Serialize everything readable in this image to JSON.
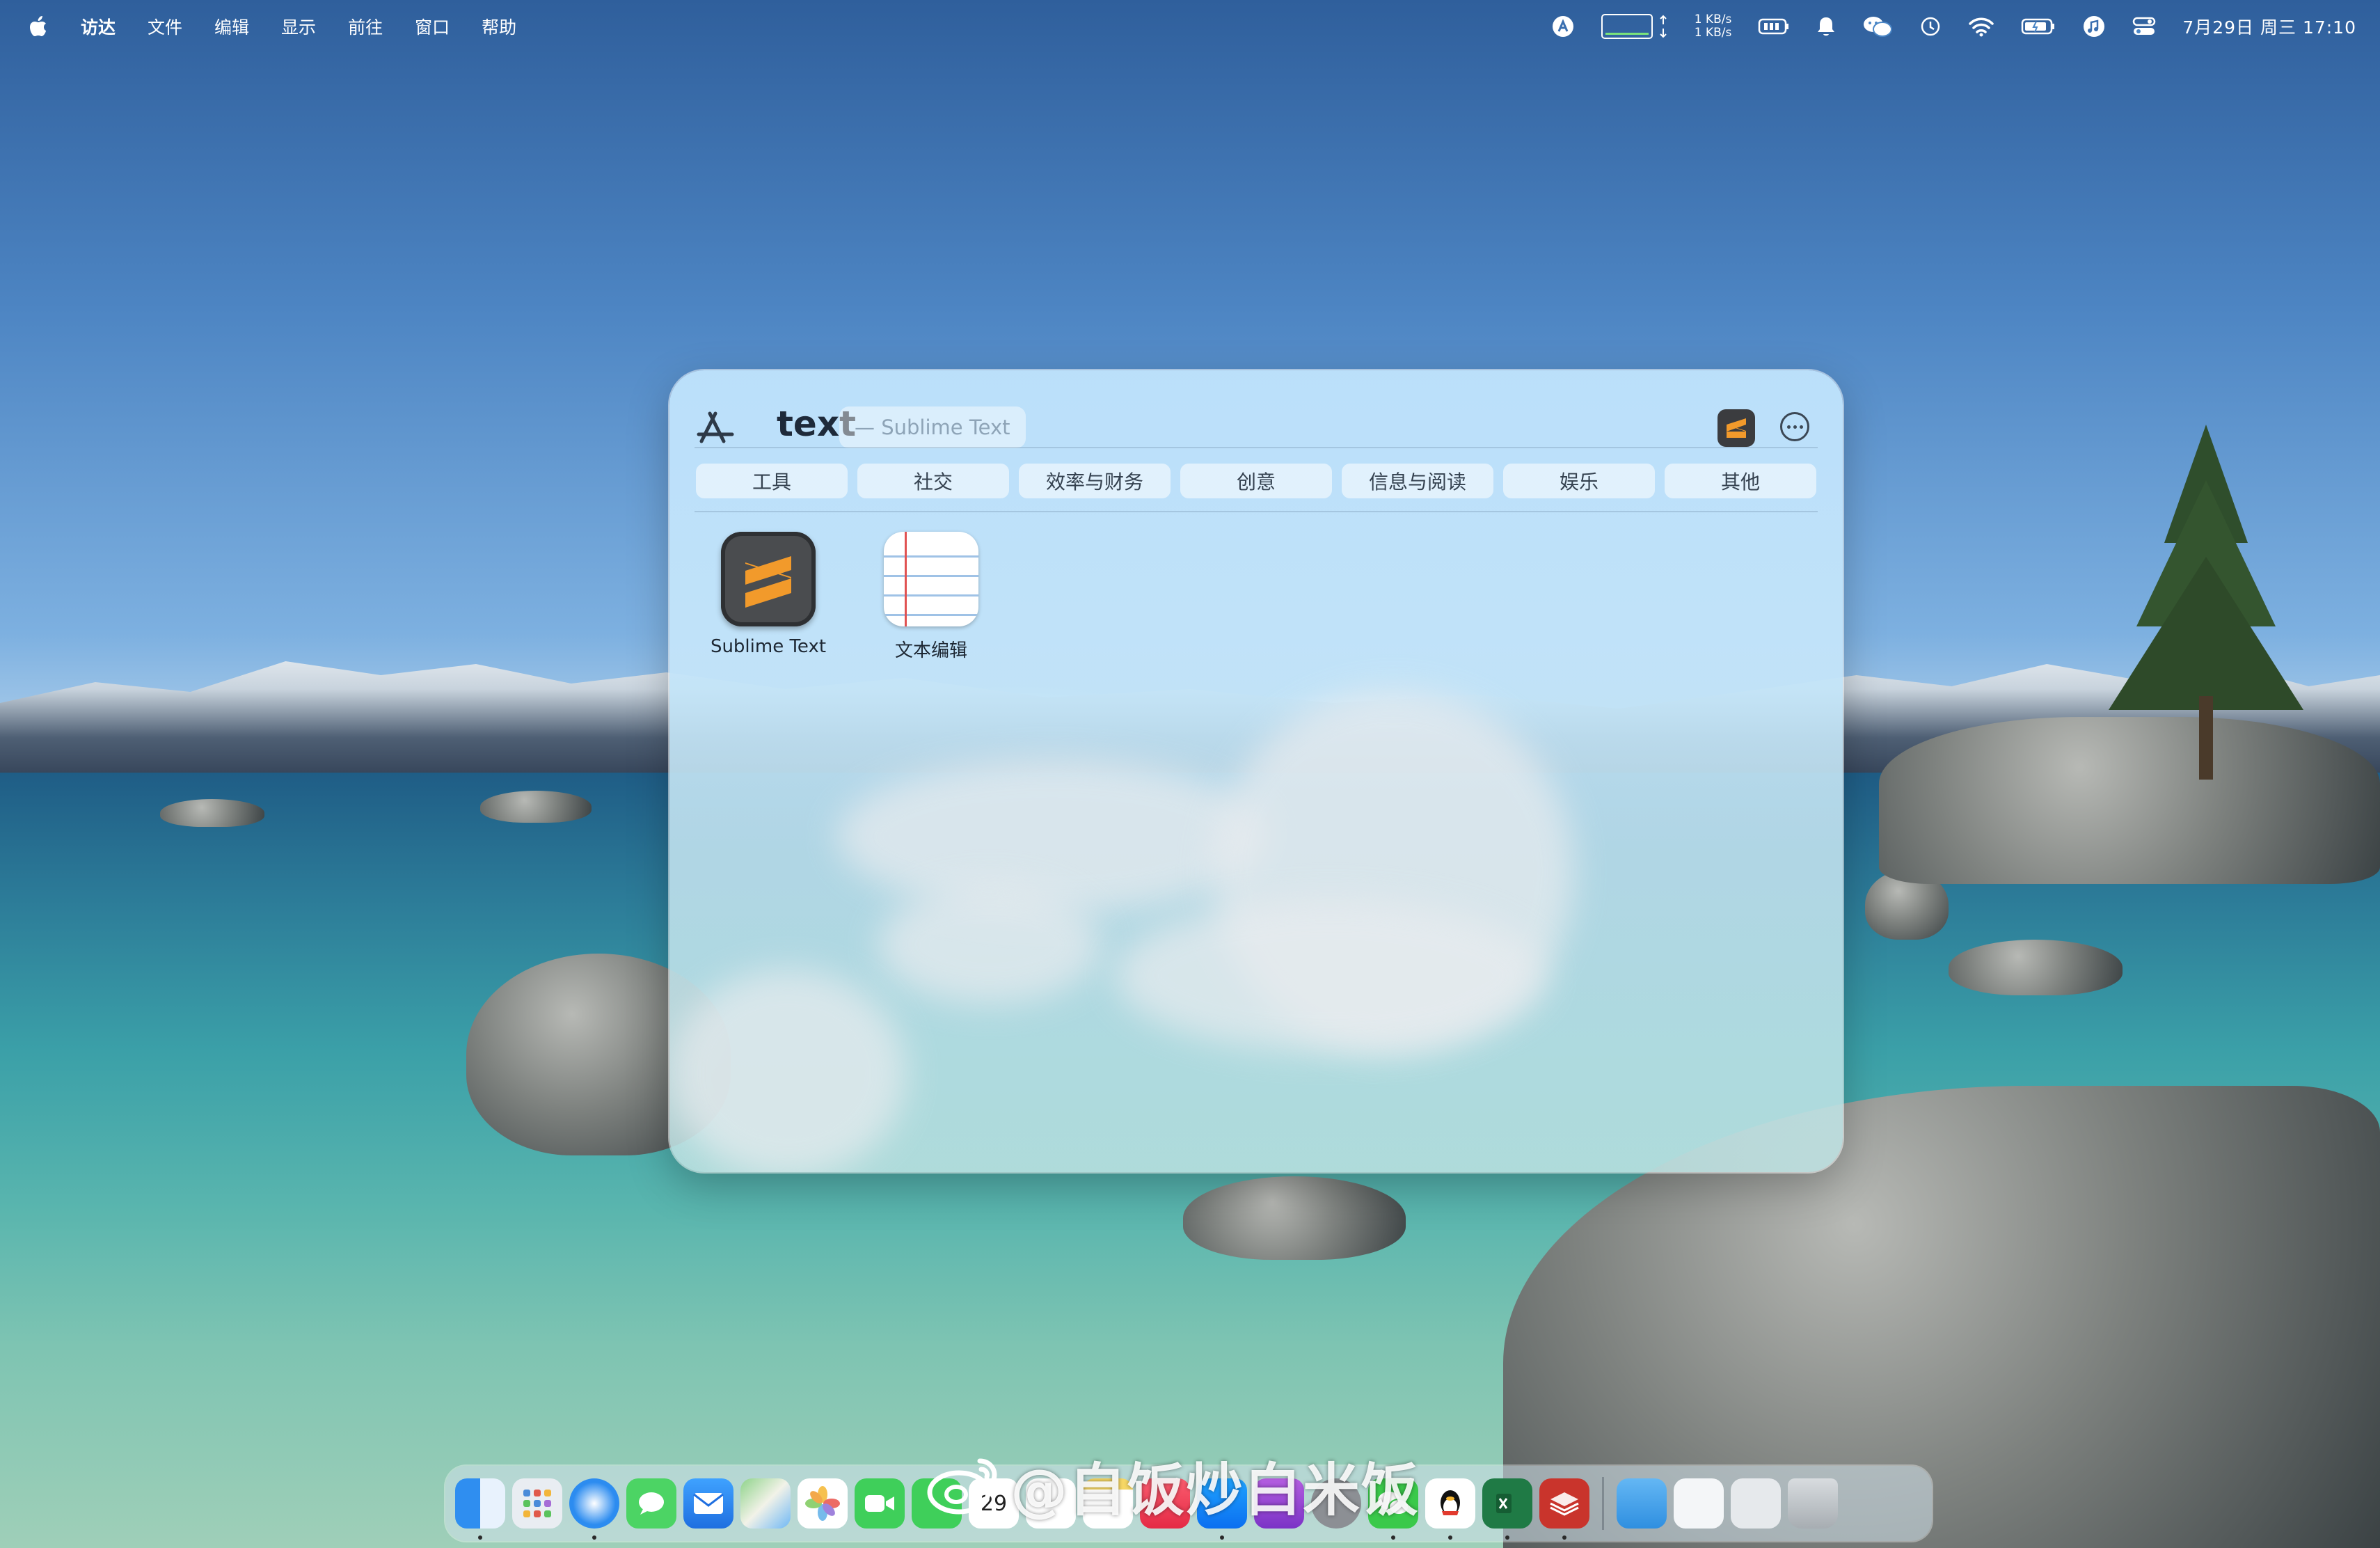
{
  "menubar": {
    "app_name": "访达",
    "menus": [
      "文件",
      "编辑",
      "显示",
      "前往",
      "窗口",
      "帮助"
    ],
    "network": {
      "up": "1 KB/s",
      "down": "1 KB/s"
    },
    "datetime": "7月29日 周三 17:10",
    "status_icons": [
      "app-store-a-icon",
      "activity-graph-icon",
      "network-speed",
      "battery-device-icon",
      "bell-icon",
      "wechat-icon",
      "time-machine-icon",
      "wifi-icon",
      "battery-icon",
      "music-icon",
      "control-center-icon"
    ]
  },
  "launcher": {
    "query": "text",
    "suggestion": "— Sublime Text",
    "categories": [
      "工具",
      "社交",
      "效率与财务",
      "创意",
      "信息与阅读",
      "娱乐",
      "其他"
    ],
    "apps": [
      {
        "name": "Sublime Text",
        "icon": "sublime-text-icon"
      },
      {
        "name": "文本编辑",
        "icon": "textedit-icon"
      }
    ]
  },
  "dock": {
    "apps": [
      "finder",
      "launchpad",
      "safari",
      "messages",
      "mail",
      "maps",
      "photos",
      "facetime",
      "phone",
      "calendar",
      "reminders",
      "notes",
      "music",
      "app-store",
      "podcasts",
      "system-settings",
      "wechat",
      "qq",
      "excel",
      "redis-desktop"
    ],
    "folders": [
      "downloads-folder",
      "document-stack",
      "screenshots-stack",
      "trash"
    ]
  },
  "watermark": "@自饭炒白米饭",
  "colors": {
    "panel_bg": "#c4e5fa",
    "sublime_orange": "#f29a2b",
    "text_dark": "#1e2a3a"
  }
}
